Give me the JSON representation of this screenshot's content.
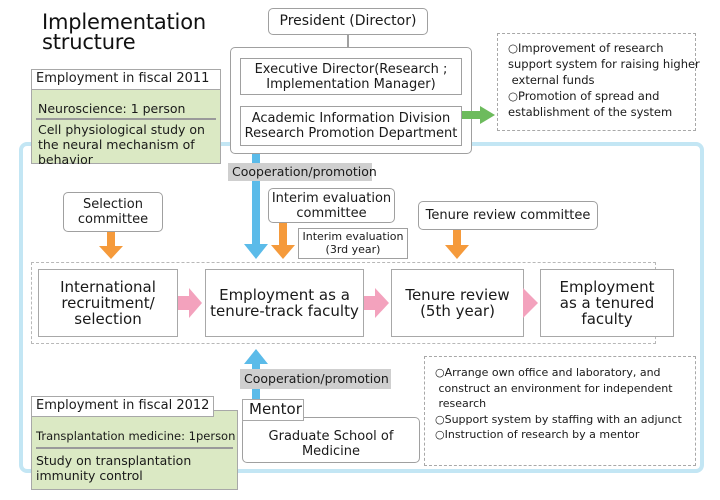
{
  "title": {
    "line1": "Implementation",
    "line2": "structure"
  },
  "organization": {
    "president": "President (Director)",
    "executive_director_line1": "Executive Director(Research ;",
    "executive_director_line2": "Implementation Manager)",
    "academic_line1": "Academic Information Division",
    "academic_line2": "Research Promotion Department"
  },
  "top_note": {
    "lines": [
      "○Improvement of research",
      "support system for raising higher",
      " external funds",
      "○Promotion of spread and",
      "establishment of the system"
    ]
  },
  "employment_2011": {
    "tag": "Employment in fiscal 2011",
    "field": "Neuroscience: 1 person",
    "desc_line1": "Cell physiological study on",
    "desc_line2": "the neural mechanism of",
    "desc_line3": "behavior"
  },
  "employment_2012": {
    "tag": "Employment in fiscal 2012",
    "field": "Transplantation medicine: 1person",
    "desc_line1": "Study on transplantation",
    "desc_line2": "immunity control"
  },
  "cooperation": {
    "top": "Cooperation/promotion",
    "bottom": "Cooperation/promotion"
  },
  "committees": {
    "selection_line1": "Selection",
    "selection_line2": "committee",
    "interim_line1": "Interim evaluation",
    "interim_line2": "committee",
    "interim_eval_line1": "Interim evaluation",
    "interim_eval_line2": "(3rd year)",
    "tenure": "Tenure review committee"
  },
  "process_steps": [
    {
      "line1": "International",
      "line2": "recruitment/",
      "line3": "selection"
    },
    {
      "line1": "Employment as a",
      "line2": "tenure-track faculty"
    },
    {
      "line1": "Tenure review",
      "line2": "(5th year)"
    },
    {
      "line1": "Employment",
      "line2": "as a tenured",
      "line3": "faculty"
    }
  ],
  "mentor": {
    "tag": "Mentor",
    "school_line1": "Graduate School of",
    "school_line2": "Medicine"
  },
  "bottom_note": {
    "lines": [
      "○Arrange own office and laboratory, and",
      " construct an environment for independent",
      " research",
      "○Support system by staffing with an adjunct",
      "○Instruction of research by a mentor"
    ]
  },
  "colors": {
    "frame": "#c3e6f4",
    "blue_arrow": "#5bbbe9",
    "orange_arrow": "#f59a3b",
    "pink_arrow": "#f3a2bd",
    "green_arrow": "#6dbb5d",
    "green_card": "#dbe9c4",
    "coop_label": "#cfcfcf"
  }
}
